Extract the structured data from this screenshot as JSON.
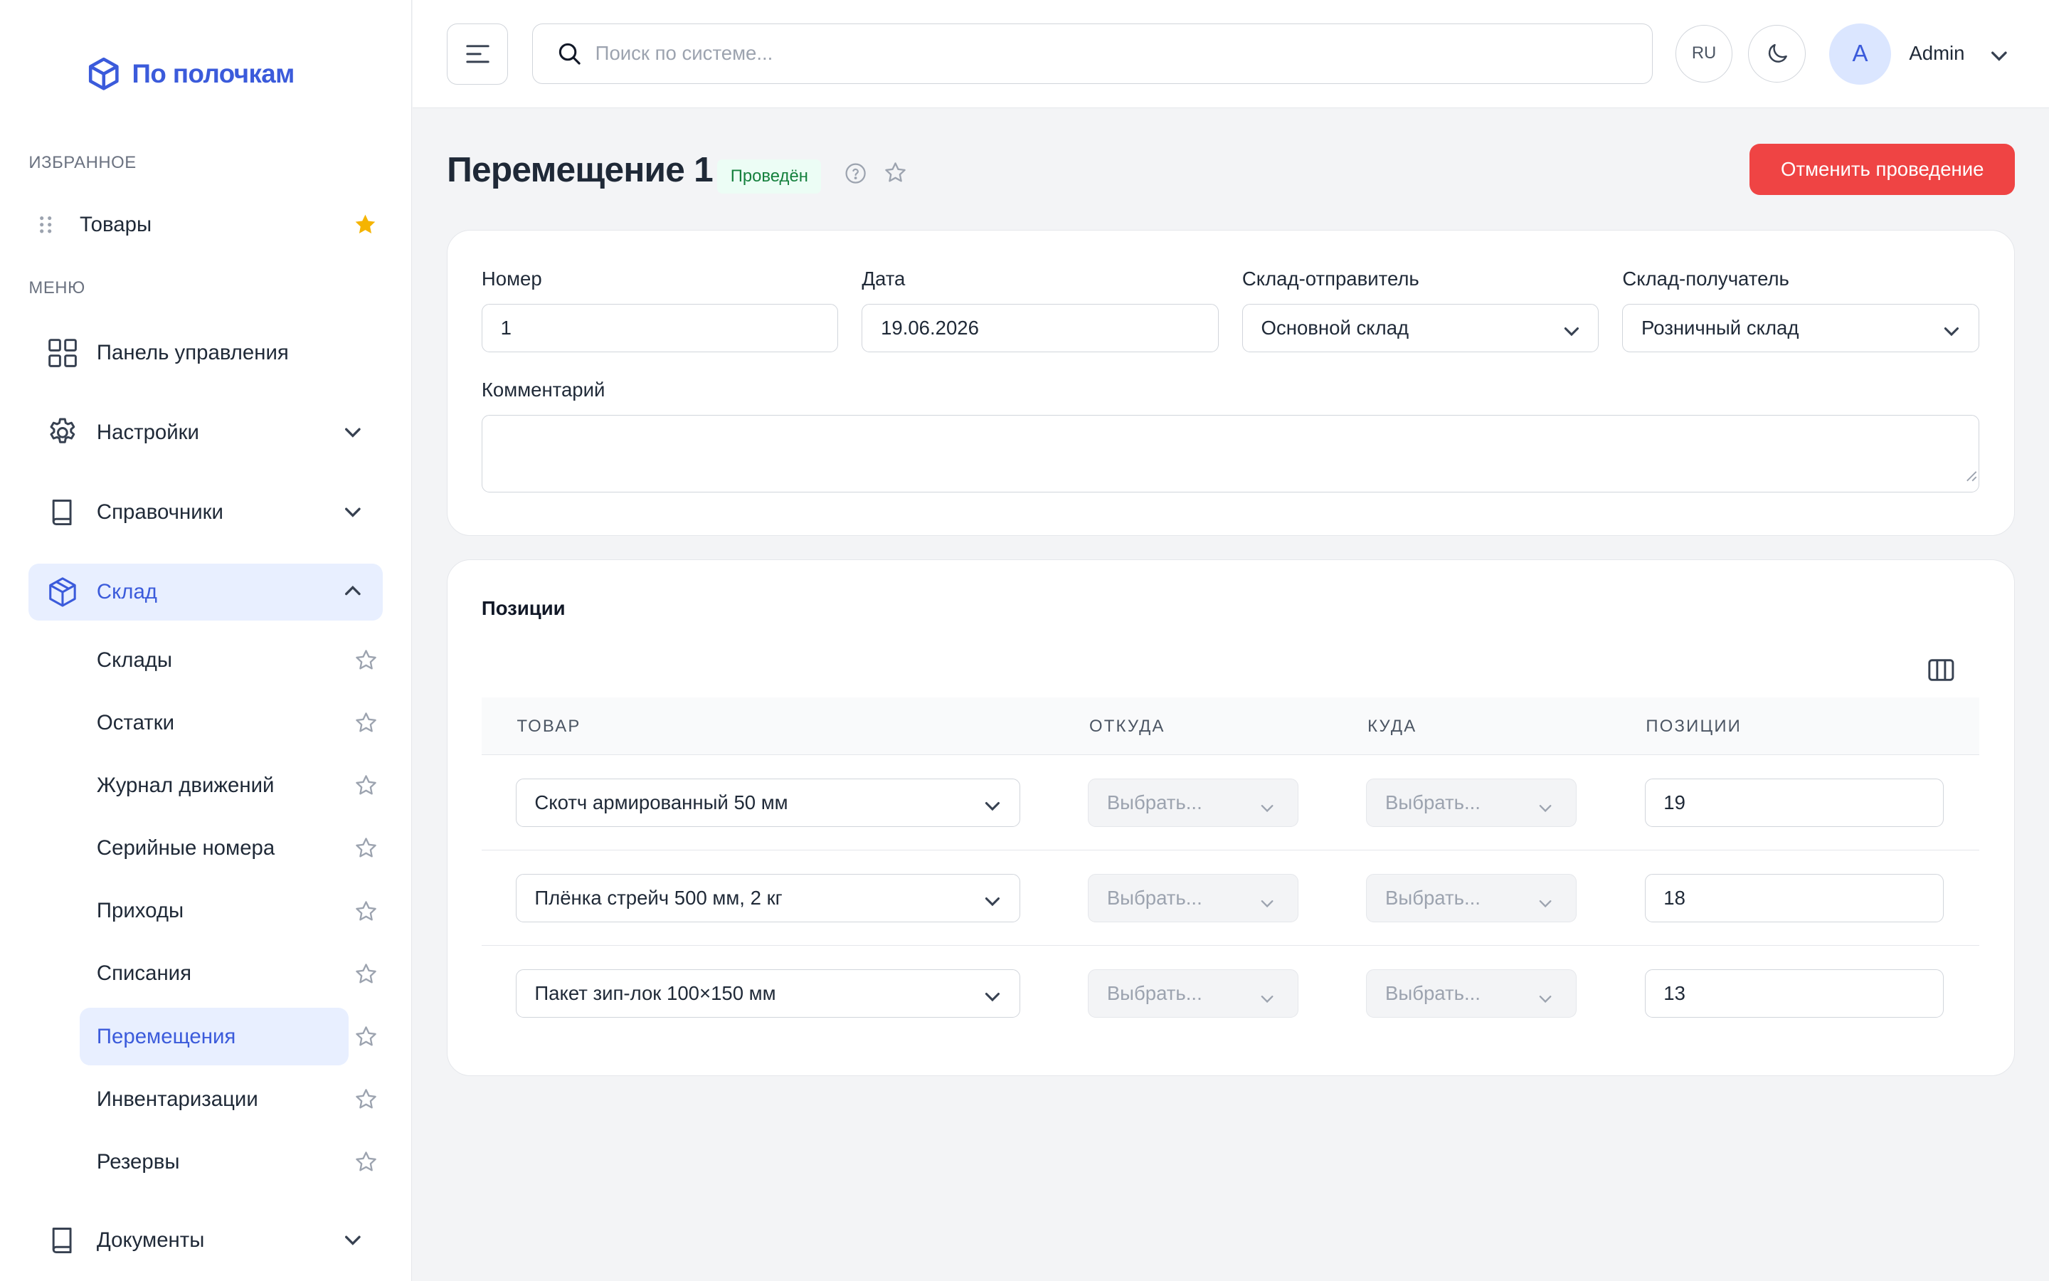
{
  "app": {
    "logo_text": "По полочкам",
    "brand_color": "#3b5bdb"
  },
  "sidebar": {
    "favorites_label": "ИЗБРАННОЕ",
    "favorites": [
      {
        "label": "Товары",
        "starred": true
      }
    ],
    "menu_label": "МЕНЮ",
    "items": [
      {
        "label": "Панель управления",
        "icon": "grid-icon"
      },
      {
        "label": "Настройки",
        "icon": "gear-icon",
        "expandable": true
      },
      {
        "label": "Справочники",
        "icon": "book-icon",
        "expandable": true
      },
      {
        "label": "Склад",
        "icon": "box-icon",
        "expanded": true,
        "active": true
      },
      {
        "label": "Документы",
        "icon": "book-icon",
        "expandable": true
      }
    ],
    "subitems": [
      {
        "label": "Склады"
      },
      {
        "label": "Остатки"
      },
      {
        "label": "Журнал движений"
      },
      {
        "label": "Серийные номера"
      },
      {
        "label": "Приходы"
      },
      {
        "label": "Списания"
      },
      {
        "label": "Перемещения",
        "active": true
      },
      {
        "label": "Инвентаризации"
      },
      {
        "label": "Резервы"
      }
    ]
  },
  "topbar": {
    "search_placeholder": "Поиск по системе...",
    "lang": "RU",
    "avatar_letter": "A",
    "user_name": "Admin"
  },
  "page": {
    "title": "Перемещение 1",
    "status": "Проведён",
    "cancel_button": "Отменить проведение"
  },
  "form": {
    "number_label": "Номер",
    "number_value": "1",
    "date_label": "Дата",
    "date_value": "19.06.2026",
    "sender_label": "Склад-отправитель",
    "sender_value": "Основной склад",
    "receiver_label": "Склад-получатель",
    "receiver_value": "Розничный склад",
    "comment_label": "Комментарий",
    "comment_value": ""
  },
  "positions": {
    "title": "Позиции",
    "columns": [
      "ТОВАР",
      "ОТКУДА",
      "КУДА",
      "ПОЗИЦИИ"
    ],
    "rows": [
      {
        "product": "Скотч армированный 50 мм",
        "from": "Выбрать...",
        "to": "Выбрать...",
        "qty": "19"
      },
      {
        "product": "Плёнка стрейч 500 мм, 2 кг",
        "from": "Выбрать...",
        "to": "Выбрать...",
        "qty": "18"
      },
      {
        "product": "Пакет зип-лок 100×150 мм",
        "from": "Выбрать...",
        "to": "Выбрать...",
        "qty": "13"
      }
    ]
  },
  "colors": {
    "accent": "#3b5bdb",
    "danger": "#ef4444",
    "success": "#15803d",
    "star": "#f5b400"
  }
}
